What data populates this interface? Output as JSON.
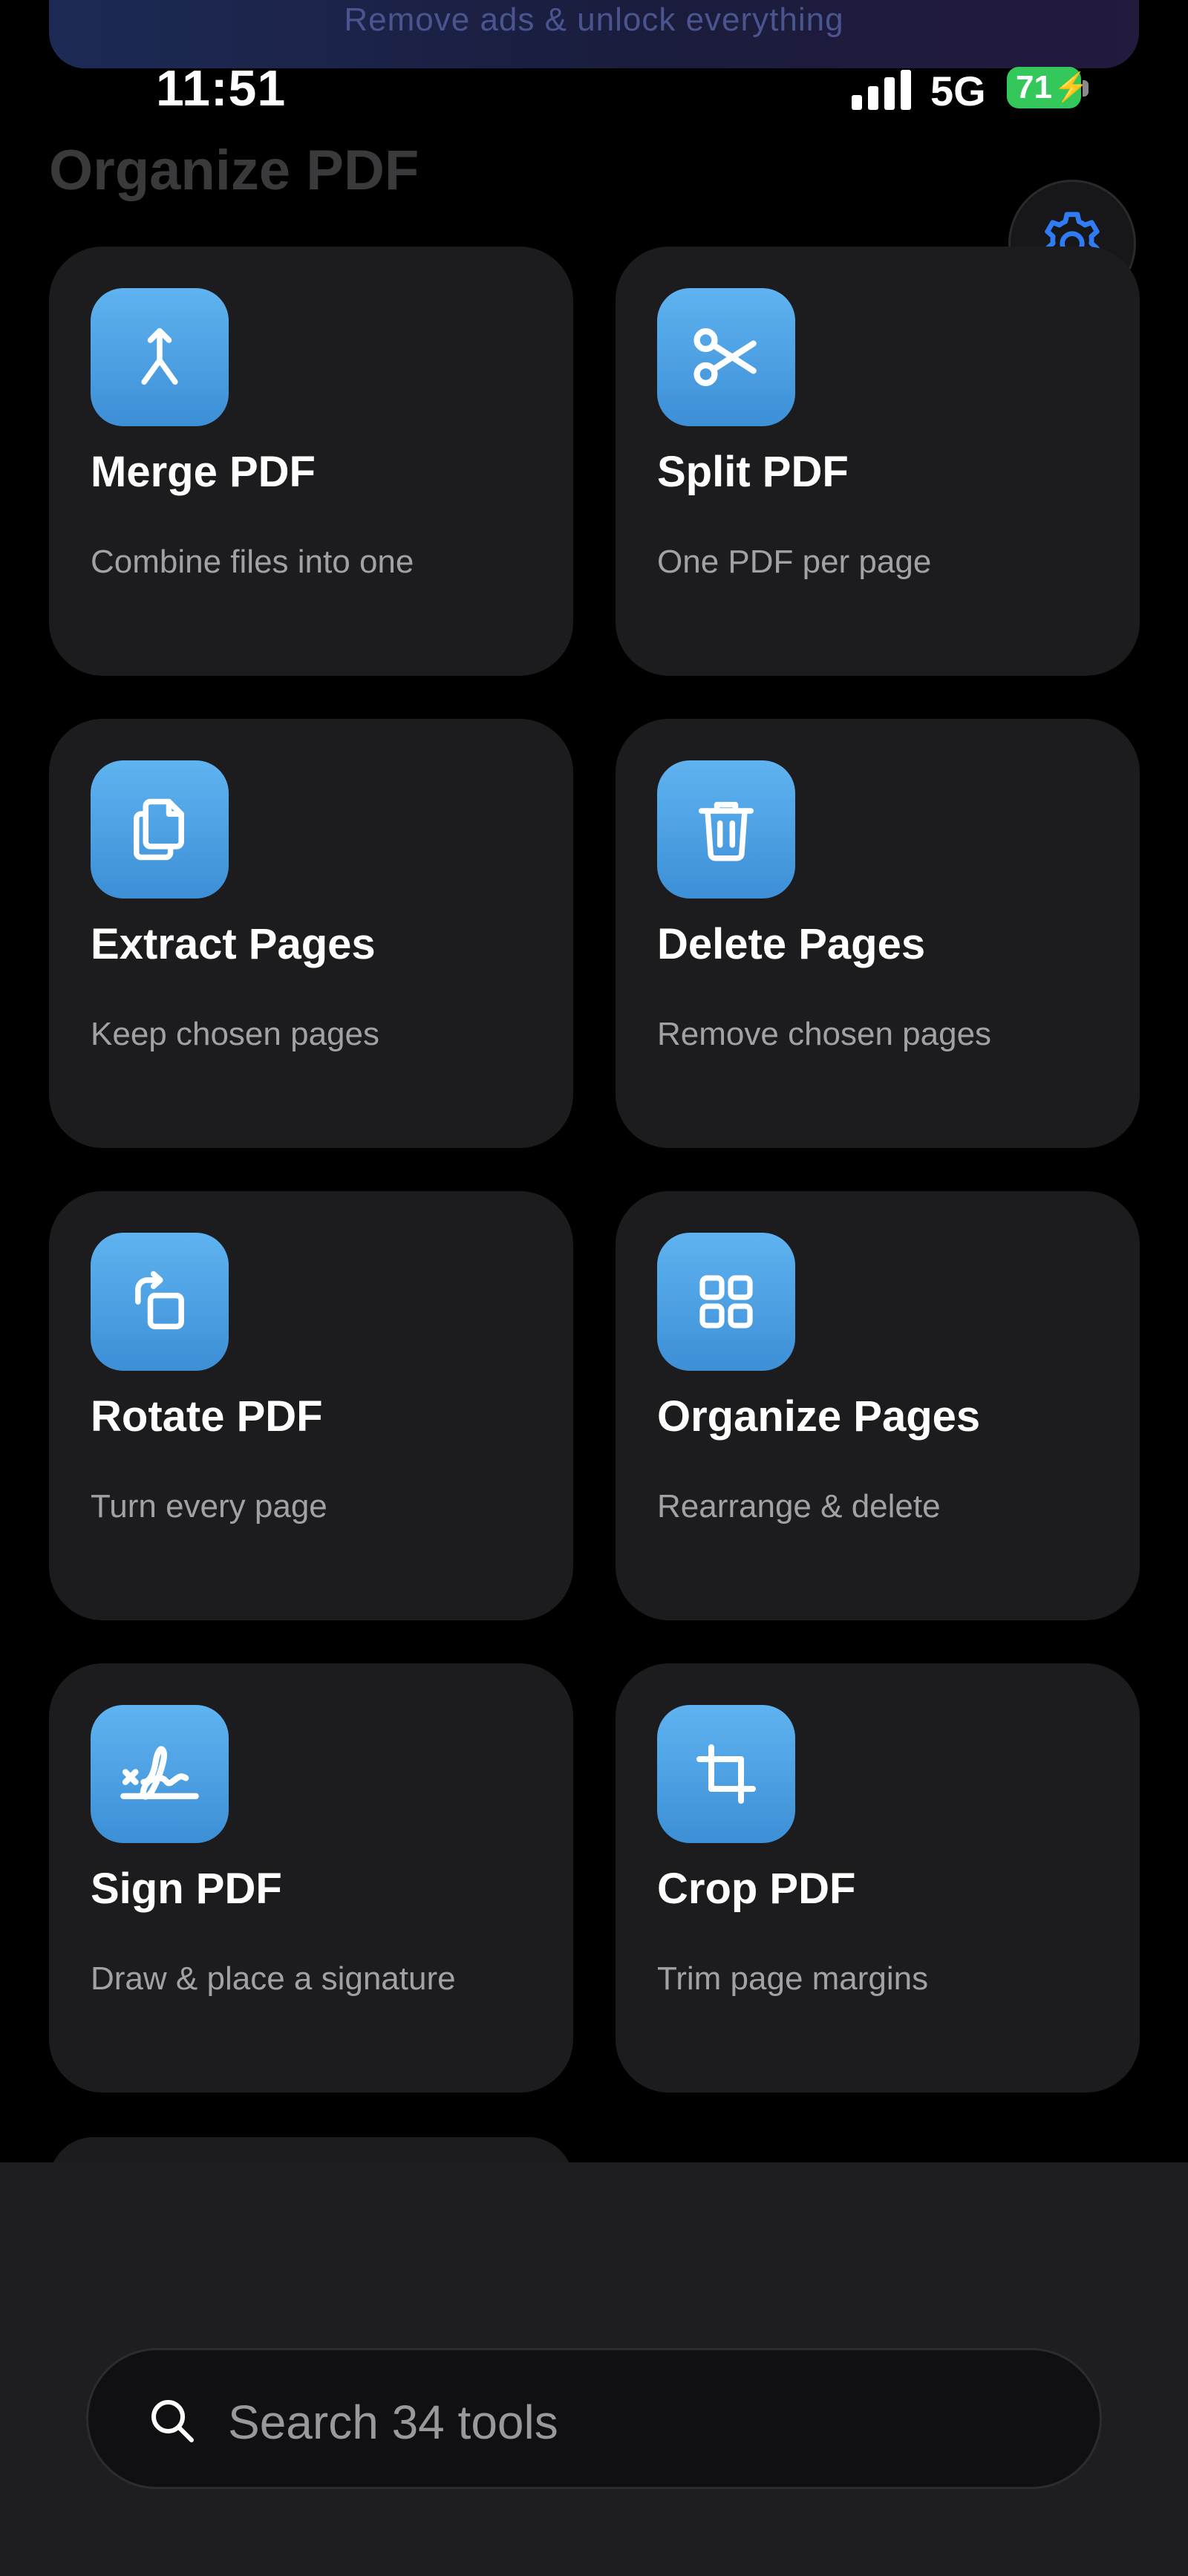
{
  "promo": {
    "text": "Remove ads & unlock everything"
  },
  "status_bar": {
    "time": "11:51",
    "network": "5G",
    "battery": "71"
  },
  "page": {
    "title": "Organize PDF"
  },
  "settings": {
    "icon": "gear-icon"
  },
  "tools": [
    {
      "title": "Merge PDF",
      "subtitle": "Combine files into one",
      "icon": "merge-icon"
    },
    {
      "title": "Split PDF",
      "subtitle": "One PDF per page",
      "icon": "scissors-icon"
    },
    {
      "title": "Extract Pages",
      "subtitle": "Keep chosen pages",
      "icon": "copy-pages-icon"
    },
    {
      "title": "Delete Pages",
      "subtitle": "Remove chosen pages",
      "icon": "trash-icon"
    },
    {
      "title": "Rotate PDF",
      "subtitle": "Turn every page",
      "icon": "rotate-icon"
    },
    {
      "title": "Organize Pages",
      "subtitle": "Rearrange & delete",
      "icon": "grid-icon"
    },
    {
      "title": "Sign PDF",
      "subtitle": "Draw & place a signature",
      "icon": "signature-icon"
    },
    {
      "title": "Crop PDF",
      "subtitle": "Trim page margins",
      "icon": "crop-icon"
    }
  ],
  "search": {
    "placeholder": "Search 34 tools",
    "icon": "search-icon"
  },
  "colors": {
    "background": "#000000",
    "card": "#1c1c1e",
    "icon_tile": "#4a9fe3",
    "accent": "#2f7cf6",
    "battery": "#34c759"
  }
}
